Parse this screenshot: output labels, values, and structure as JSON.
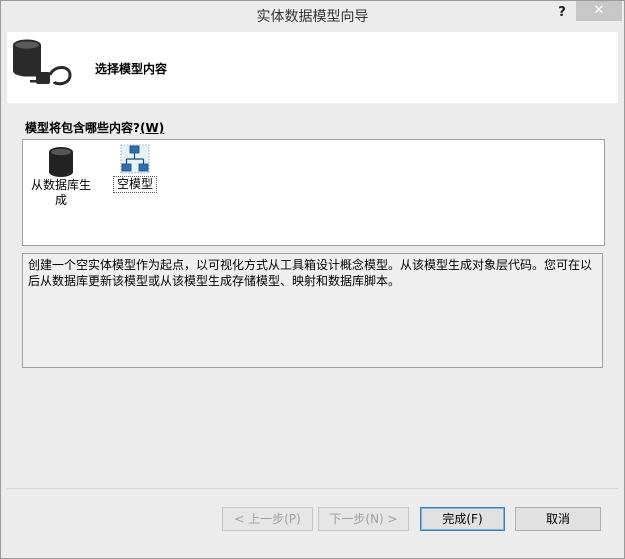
{
  "window": {
    "title": "实体数据模型向导",
    "help_label": "?",
    "close_label": "✕"
  },
  "header": {
    "title": "选择模型内容",
    "icon": "database-plug-icon"
  },
  "prompt": {
    "text": "模型将包含哪些内容?",
    "accel": "(W)"
  },
  "model_options": [
    {
      "label": "从数据库生成",
      "icon": "database-icon",
      "selected": false
    },
    {
      "label": "空模型",
      "icon": "empty-model-icon",
      "selected": true
    }
  ],
  "description": "创建一个空实体模型作为起点，以可视化方式从工具箱设计概念模型。从该模型生成对象层代码。您可在以后从数据库更新该模型或从该模型生成存储模型、映射和数据库脚本。",
  "buttons": {
    "back": "< 上一步(P)",
    "next": "下一步(N) >",
    "finish": "完成(F)",
    "cancel": "取消"
  },
  "colors": {
    "accent_border": "#3c7fb1",
    "close_bg": "#c7c7c7",
    "header_bg": "#ffffff"
  }
}
